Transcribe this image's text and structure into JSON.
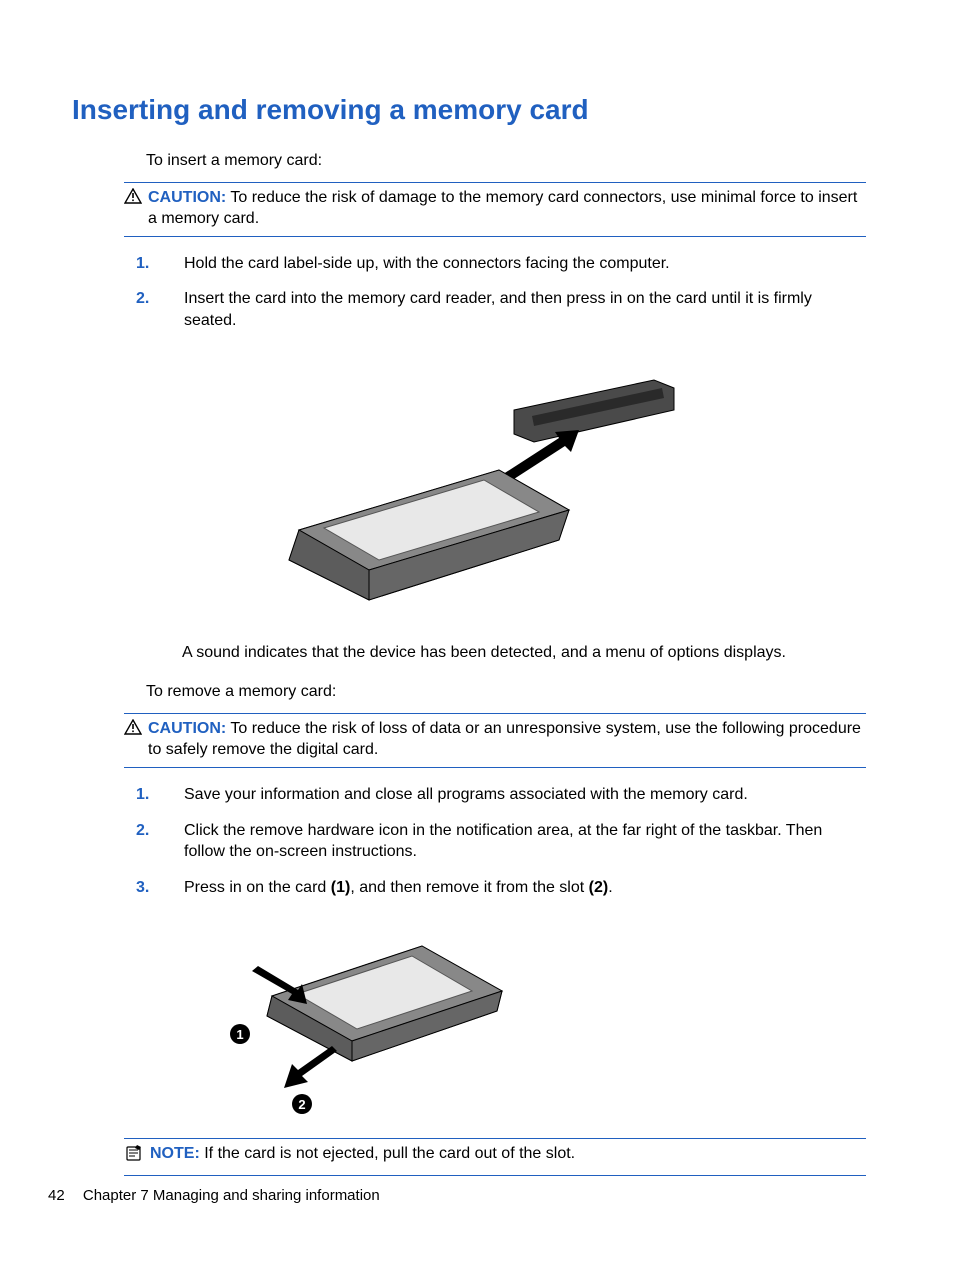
{
  "heading": "Inserting and removing a memory card",
  "intro_insert": "To insert a memory card:",
  "caution_insert": {
    "label": "CAUTION:",
    "text": "To reduce the risk of damage to the memory card connectors, use minimal force to insert a memory card."
  },
  "insert_steps": [
    "Hold the card label-side up, with the connectors facing the computer.",
    "Insert the card into the memory card reader, and then press in on the card until it is firmly seated."
  ],
  "insert_result": "A sound indicates that the device has been detected, and a menu of options displays.",
  "intro_remove": "To remove a memory card:",
  "caution_remove": {
    "label": "CAUTION:",
    "text": "To reduce the risk of loss of data or an unresponsive system, use the following procedure to safely remove the digital card."
  },
  "remove_steps": [
    "Save your information and close all programs associated with the memory card.",
    "Click the remove hardware icon in the notification area, at the far right of the taskbar. Then follow the on-screen instructions.",
    {
      "pre": "Press in on the card ",
      "b1": "(1)",
      "mid": ", and then remove it from the slot ",
      "b2": "(2)",
      "post": "."
    }
  ],
  "note": {
    "label": "NOTE:",
    "text": "If the card is not ejected, pull the card out of the slot."
  },
  "footer": {
    "page": "42",
    "chapter": "Chapter 7   Managing and sharing information"
  }
}
